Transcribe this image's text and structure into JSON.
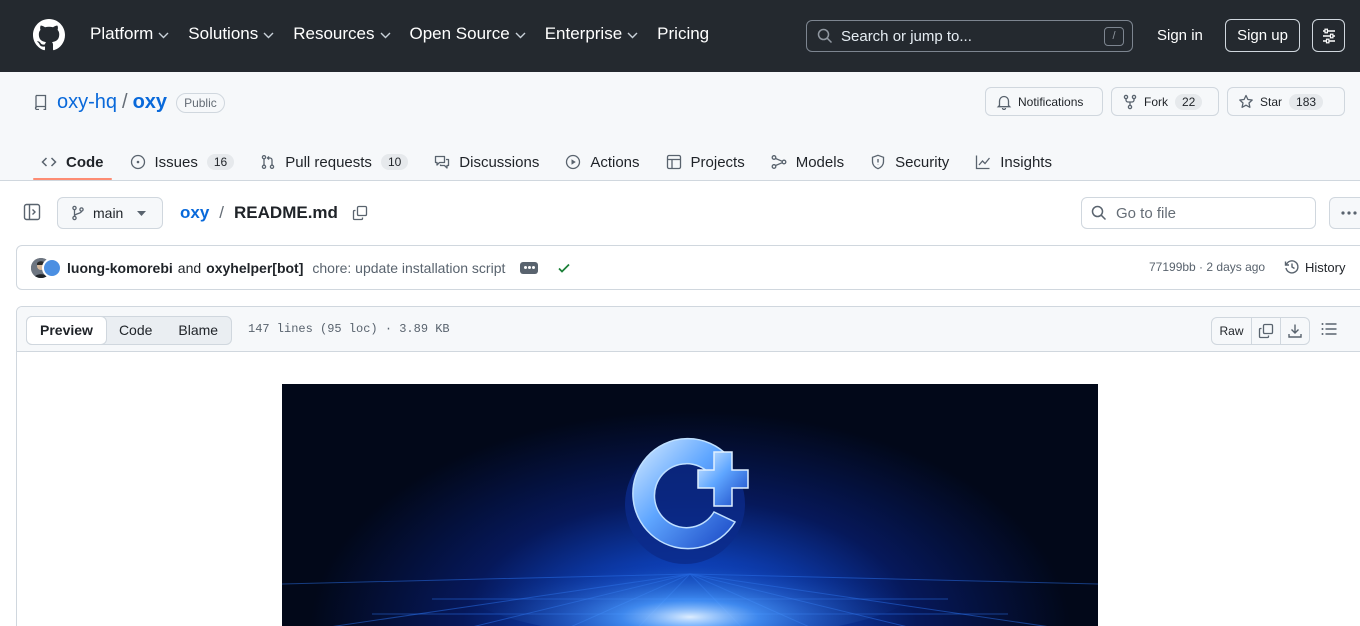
{
  "header": {
    "nav": [
      {
        "label": "Platform",
        "chevron": true
      },
      {
        "label": "Solutions",
        "chevron": true
      },
      {
        "label": "Resources",
        "chevron": true
      },
      {
        "label": "Open Source",
        "chevron": true
      },
      {
        "label": "Enterprise",
        "chevron": true
      },
      {
        "label": "Pricing",
        "chevron": false
      }
    ],
    "search_placeholder": "Search or jump to...",
    "search_shortcut": "/",
    "sign_in": "Sign in",
    "sign_up": "Sign up"
  },
  "repo": {
    "owner": "oxy-hq",
    "separator": "/",
    "name": "oxy",
    "visibility": "Public",
    "notifications_label": "Notifications",
    "fork_label": "Fork",
    "fork_count": "22",
    "star_label": "Star",
    "star_count": "183"
  },
  "tabs": [
    {
      "label": "Code",
      "icon": "code-icon",
      "count": ""
    },
    {
      "label": "Issues",
      "icon": "issue-icon",
      "count": "16"
    },
    {
      "label": "Pull requests",
      "icon": "pull-request-icon",
      "count": "10"
    },
    {
      "label": "Discussions",
      "icon": "discussions-icon",
      "count": ""
    },
    {
      "label": "Actions",
      "icon": "play-icon",
      "count": ""
    },
    {
      "label": "Projects",
      "icon": "table-icon",
      "count": ""
    },
    {
      "label": "Models",
      "icon": "models-icon",
      "count": ""
    },
    {
      "label": "Security",
      "icon": "shield-icon",
      "count": ""
    },
    {
      "label": "Insights",
      "icon": "graph-icon",
      "count": ""
    }
  ],
  "filenav": {
    "branch": "main",
    "root": "oxy",
    "separator": "/",
    "file": "README.md",
    "goto_placeholder": "Go to file"
  },
  "commit": {
    "author1": "luong-komorebi",
    "and_text": "and",
    "author2": "oxyhelper[bot]",
    "message": "chore: update installation script",
    "meta": "77199bb · 2 days ago",
    "history_label": "History"
  },
  "file": {
    "views": [
      "Preview",
      "Code",
      "Blame"
    ],
    "active_view": "Preview",
    "info": "147 lines (95 loc) · 3.89 KB",
    "raw_label": "Raw"
  },
  "colors": {
    "header_bg": "#24292f",
    "link": "#0969da",
    "active_tab_underline": "#fd8c73",
    "success": "#1a7f37"
  }
}
